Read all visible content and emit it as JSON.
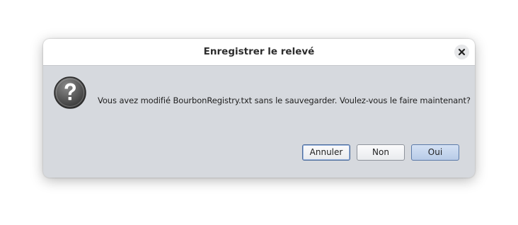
{
  "dialog": {
    "title": "Enregistrer le relevé",
    "close_icon": "close-icon",
    "question_icon": "question-mark-icon",
    "message": "Vous avez modifié BourbonRegistry.txt sans le sauvegarder. Voulez-vous le faire maintenant?",
    "buttons": {
      "cancel_label": "Annuler",
      "no_label": "Non",
      "yes_label": "Oui"
    },
    "focused_button": "Annuler",
    "default_button": "Oui"
  },
  "colors": {
    "dialog_body": "#d6d9de",
    "titlebar": "#ffffff",
    "default_button": "#c3d4ec",
    "focus_border": "#4a6a9a"
  }
}
